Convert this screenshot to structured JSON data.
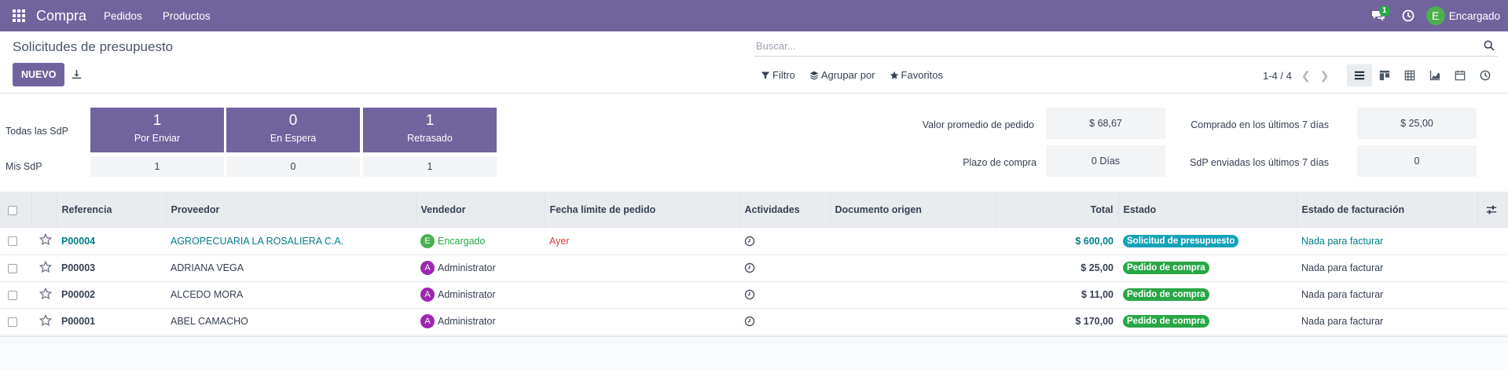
{
  "navbar": {
    "app_name": "Compra",
    "menus": [
      "Pedidos",
      "Productos"
    ],
    "messages_count": "1",
    "user_initial": "E",
    "user_name": "Encargado",
    "bg_color": "#71639e"
  },
  "control": {
    "title": "Solicitudes de presupuesto",
    "new_label": "NUEVO",
    "search_placeholder": "Buscar...",
    "filter_label": "Filtro",
    "groupby_label": "Agrupar por",
    "favorites_label": "Favoritos",
    "pager": "1-4 / 4",
    "views": [
      "list-icon",
      "kanban-icon",
      "pivot-icon",
      "graph-icon",
      "calendar-icon",
      "activity-icon"
    ]
  },
  "dashboard": {
    "all_label": "Todas las SdP",
    "mine_label": "Mis SdP",
    "tiles": [
      {
        "count": "1",
        "label": "Por Enviar",
        "mine": "1"
      },
      {
        "count": "0",
        "label": "En Espera",
        "mine": "0"
      },
      {
        "count": "1",
        "label": "Retrasado",
        "mine": "1"
      }
    ],
    "kpis": {
      "avg_label": "Valor promedio de pedido",
      "avg_value": "$ 68,67",
      "purchased_label": "Comprado en los últimos 7 días",
      "purchased_value": "$ 25,00",
      "lead_label": "Plazo de compra",
      "lead_value": "0 Días",
      "sent_label": "SdP enviadas los últimos 7 días",
      "sent_value": "0"
    }
  },
  "table": {
    "headers": {
      "ref": "Referencia",
      "vendor": "Proveedor",
      "salesman": "Vendedor",
      "deadline": "Fecha límite de pedido",
      "activities": "Actividades",
      "origin": "Documento origen",
      "total": "Total",
      "state": "Estado",
      "billing": "Estado de facturación"
    },
    "rows": [
      {
        "ref": "P00004",
        "vendor": "AGROPECUARIA LA ROSALIERA C.A.",
        "salesman_initial": "E",
        "salesman": "Encargado",
        "deadline": "Ayer",
        "origin": "",
        "total": "$ 600,00",
        "state": "Solicitud de presupuesto",
        "billing": "Nada para facturar"
      },
      {
        "ref": "P00003",
        "vendor": "ADRIANA VEGA",
        "salesman_initial": "A",
        "salesman": "Administrator",
        "deadline": "",
        "origin": "",
        "total": "$ 25,00",
        "state": "Pedido de compra",
        "billing": "Nada para facturar"
      },
      {
        "ref": "P00002",
        "vendor": "ALCEDO MORA",
        "salesman_initial": "A",
        "salesman": "Administrator",
        "deadline": "",
        "origin": "",
        "total": "$ 11,00",
        "state": "Pedido de compra",
        "billing": "Nada para facturar"
      },
      {
        "ref": "P00001",
        "vendor": "ABEL CAMACHO",
        "salesman_initial": "A",
        "salesman": "Administrator",
        "deadline": "",
        "origin": "",
        "total": "$ 170,00",
        "state": "Pedido de compra",
        "billing": "Nada para facturar"
      }
    ]
  }
}
